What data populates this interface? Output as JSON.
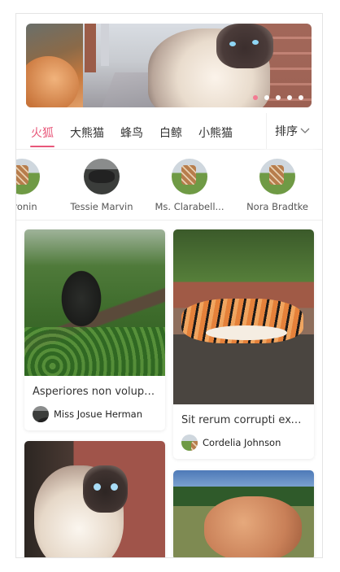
{
  "banner": {
    "dots": [
      true,
      false,
      false,
      false,
      false
    ]
  },
  "tabs": {
    "items": [
      "火狐",
      "大熊猫",
      "蜂鸟",
      "白鲸",
      "小熊猫"
    ],
    "active_index": 0,
    "sort_label": "排序"
  },
  "users": [
    {
      "name": "Cronin",
      "avatar": "giraffe-photo"
    },
    {
      "name": "Tessie Marvin",
      "avatar": "dark-animal-photo"
    },
    {
      "name": "Ms. Clarabell...",
      "avatar": "giraffe-photo"
    },
    {
      "name": "Nora Bradtke",
      "avatar": "giraffe-photo"
    }
  ],
  "feed": {
    "left": [
      {
        "title": "Asperiores non volupt...",
        "author": "Miss Josue Herman",
        "photo": "gorilla-photo"
      },
      {
        "title": "",
        "author": "",
        "photo": "siamese-cat-photo"
      }
    ],
    "right": [
      {
        "title": "Sit rerum corrupti exe...",
        "author": "Cordelia Johnson",
        "photo": "tiger-photo"
      },
      {
        "title": "",
        "author": "",
        "photo": "pig-photo"
      }
    ]
  },
  "colors": {
    "accent": "#e8587a",
    "dot_active": "#f4768f",
    "text": "#333333"
  }
}
